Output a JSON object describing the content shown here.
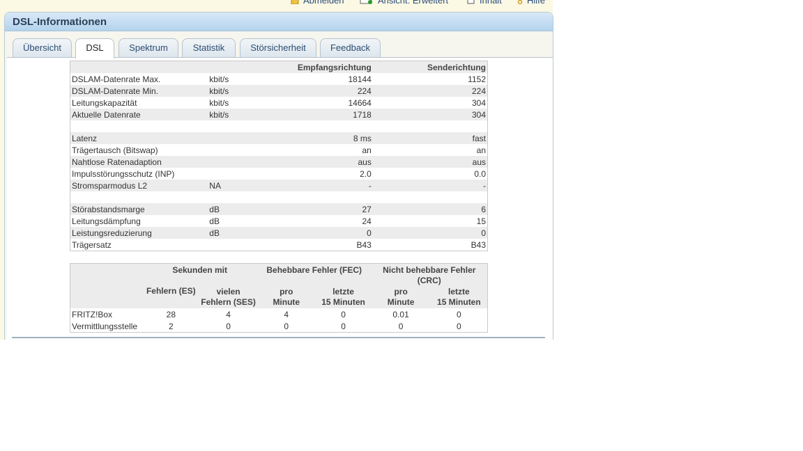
{
  "top_menu": [
    {
      "label": "Abmelden",
      "icon": "lock-icon"
    },
    {
      "label": "Ansicht: Erweitert",
      "icon": "view-icon"
    },
    {
      "label": "Inhalt",
      "icon": "contents-icon"
    },
    {
      "label": "Hilfe",
      "icon": "help-icon"
    }
  ],
  "panel_title": "DSL-Informationen",
  "tabs": [
    "Übersicht",
    "DSL",
    "Spektrum",
    "Statistik",
    "Störsicherheit",
    "Feedback"
  ],
  "active_tab": "DSL",
  "dsl_table": {
    "headers": {
      "down": "Empfangsrichtung",
      "up": "Senderichtung"
    },
    "rows": [
      {
        "label": "DSLAM-Datenrate Max.",
        "unit": "kbit/s",
        "down": "18144",
        "up": "1152"
      },
      {
        "label": "DSLAM-Datenrate Min.",
        "unit": "kbit/s",
        "down": "224",
        "up": "224"
      },
      {
        "label": "Leitungskapazität",
        "unit": "kbit/s",
        "down": "14664",
        "up": "304"
      },
      {
        "label": "Aktuelle Datenrate",
        "unit": "kbit/s",
        "down": "1718",
        "up": "304"
      },
      {
        "label": "",
        "unit": "",
        "down": "",
        "up": ""
      },
      {
        "label": "Latenz",
        "unit": "",
        "down": "8 ms",
        "up": "fast"
      },
      {
        "label": "Trägertausch (Bitswap)",
        "unit": "",
        "down": "an",
        "up": "an"
      },
      {
        "label": "Nahtlose Ratenadaption",
        "unit": "",
        "down": "aus",
        "up": "aus"
      },
      {
        "label": "Impulsstörungsschutz (INP)",
        "unit": "",
        "down": "2.0",
        "up": "0.0"
      },
      {
        "label": "Stromsparmodus L2",
        "unit": "NA",
        "down": "-",
        "up": "-"
      },
      {
        "label": "",
        "unit": "",
        "down": "",
        "up": ""
      },
      {
        "label": "Störabstandsmarge",
        "unit": "dB",
        "down": "27",
        "up": "6"
      },
      {
        "label": "Leitungsdämpfung",
        "unit": "dB",
        "down": "24",
        "up": "15"
      },
      {
        "label": "Leistungsreduzierung",
        "unit": "dB",
        "down": "0",
        "up": "0"
      },
      {
        "label": "Trägersatz",
        "unit": "",
        "down": "B43",
        "up": "B43"
      }
    ]
  },
  "error_table": {
    "group_headers": {
      "seconds": "Sekunden mit",
      "fec": "Behebbare Fehler (FEC)",
      "crc": "Nicht behebbare Fehler (CRC)"
    },
    "sub_headers": {
      "es": "Fehlern (ES)",
      "ses_1": "vielen",
      "ses_2": "Fehlern (SES)",
      "fec_min_1": "pro",
      "fec_min_2": "Minute",
      "fec_15_1": "letzte",
      "fec_15_2": "15 Minuten",
      "crc_min_1": "pro",
      "crc_min_2": "Minute",
      "crc_15_1": "letzte",
      "crc_15_2": "15 Minuten"
    },
    "rows": [
      {
        "label": "FRITZ!Box",
        "es": "28",
        "ses": "4",
        "fec_min": "4",
        "fec_15": "0",
        "crc_min": "0.01",
        "crc_15": "0"
      },
      {
        "label": "Vermittlungsstelle",
        "es": "2",
        "ses": "0",
        "fec_min": "0",
        "fec_15": "0",
        "crc_min": "0",
        "crc_15": "0"
      }
    ]
  }
}
